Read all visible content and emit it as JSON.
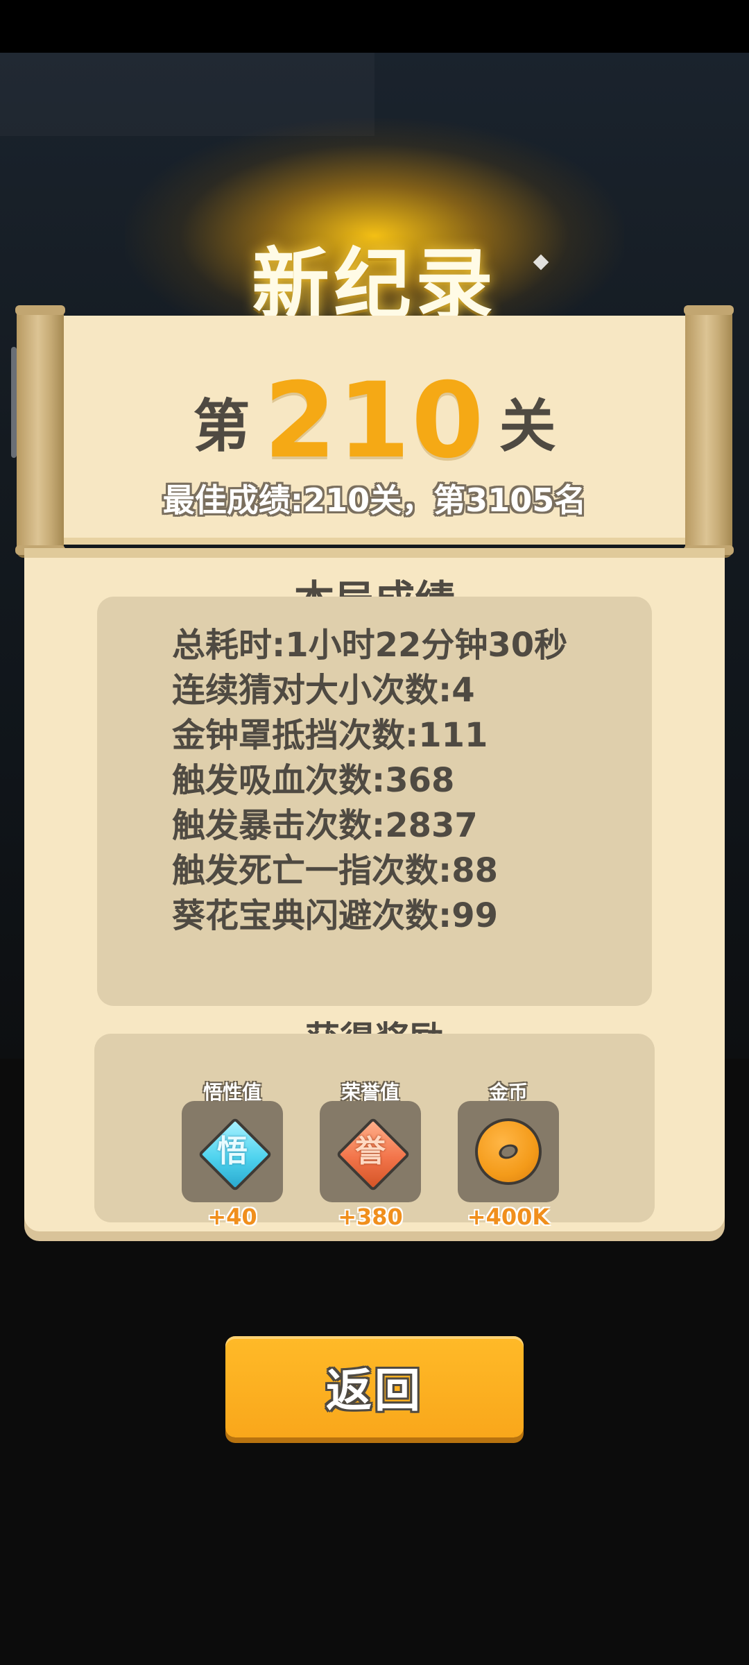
{
  "header": {
    "title": "新纪录"
  },
  "level": {
    "prefix": "第",
    "number": "210",
    "suffix": "关"
  },
  "best_score": "最佳成绩:210关，第3105名",
  "stats": {
    "title": "本局成绩",
    "lines": [
      "总耗时:1小时22分钟30秒",
      "连续猜对大小次数:4",
      "金钟罩抵挡次数:111",
      "触发吸血次数:368",
      "触发暴击次数:2837",
      "触发死亡一指次数:88",
      "葵花宝典闪避次数:99"
    ]
  },
  "rewards": {
    "title": "获得奖励",
    "items": [
      {
        "label": "悟性值",
        "glyph": "悟",
        "amount": "+40",
        "icon": "comprehension-gem-icon",
        "color": "#4fd3ee"
      },
      {
        "label": "荣誉值",
        "glyph": "誉",
        "amount": "+380",
        "icon": "honor-gem-icon",
        "color": "#f2744a"
      },
      {
        "label": "金币",
        "amount": "+400K",
        "icon": "gold-coin-icon",
        "color": "#f49b1a"
      }
    ]
  },
  "back_button": {
    "label": "返回"
  },
  "colors": {
    "accent": "#f5a915",
    "panel": "#f7e7c3",
    "text": "#4f4a42"
  }
}
